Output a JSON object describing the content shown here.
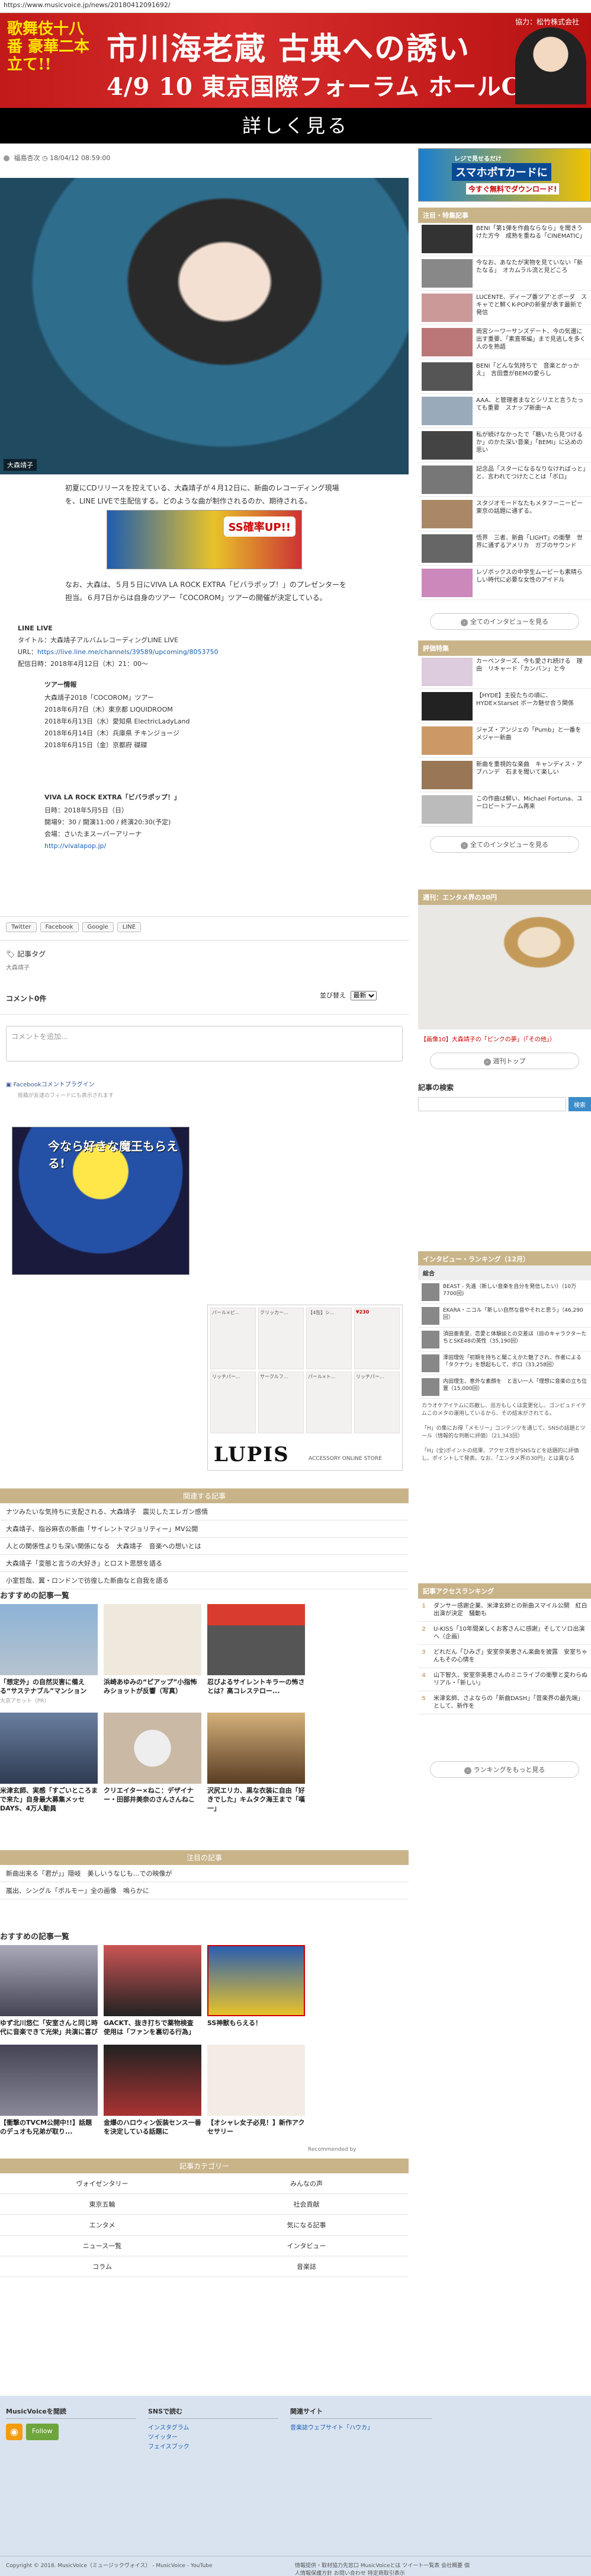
{
  "url": "https://www.musicvoice.jp/news/20180412091692/",
  "banner": {
    "left_text": "歌舞伎十八番 豪華二本立て!!",
    "sponsor": "協力：松竹株式会社",
    "title": "市川海老蔵 古典への誘い",
    "sub": "4/9 10 東京国際フォーラム ホールC"
  },
  "more_bar": "詳しく見る",
  "byline": {
    "author": "福島杏次",
    "date": "18/04/12 08:59:00"
  },
  "hero_caption": "大森靖子",
  "body_para1": "初夏にCDリリースを控えている、大森靖子が４月12日に、新曲のレコーディング現場を、LINE LIVEで生配信する。どのような曲が制作されるのか、期待される。",
  "body_para2": "なお、大森は、５月５日にVIVA LA ROCK EXTRA「ビバラポップ！」のプレゼンターを担当。６月7日からは自身のツアー「COCOROM」ツアーの開催が決定している。",
  "ad_mid": {
    "text": "SS確率UP!!"
  },
  "line_live": {
    "title": "LINE LIVE",
    "line1": "タイトル：大森靖子アルバムレコーディングLINE LIVE",
    "url_label": "URL：",
    "url": "https://live.line.me/channels/39589/upcoming/8053750",
    "date": "配信日時：2018年4月12日（木）21：00〜"
  },
  "tour": {
    "heading": "ツアー情報",
    "name": "大森靖子2018「COCOROM」ツアー",
    "d1": "2018年6月7日（木）東京都 LIQUIDROOM",
    "d2": "2018年6月13日（水）愛知県 ElectricLadyLand",
    "d3": "2018年6月14日（木）兵庫県 チキンジョージ",
    "d4": "2018年6月15日（金）京都府 磔磔"
  },
  "festival": {
    "heading": "VIVA LA ROCK EXTRA「ビバラポップ！」",
    "date": "日時：2018年5月5日（日）",
    "time": "開場9：30 / 開演11:00 / 終演20:30(予定)",
    "venue": "会場：さいたまスーパーアリーナ",
    "url": "http://vivalapop.jp/"
  },
  "share": [
    "Twitter",
    "Facebook",
    "Google",
    "LINE"
  ],
  "tags": {
    "title": "記事タグ",
    "tag": "大森靖子"
  },
  "comments": {
    "count": "コメント0件",
    "sort_label": "並び替え",
    "sort_value": "最新",
    "placeholder": "コメントを追加...",
    "fb_plugin": "Facebookコメントプラグイン",
    "fb_note": "投稿が友達のフィードにも表示されます"
  },
  "game_ad": {
    "text": "今なら好きな魔王もらえる!"
  },
  "lupis": {
    "logo": "LUPIS",
    "sub": "ACCESSORY ONLINE STORE",
    "items": [
      "パール×ピ...",
      "クリッカー...",
      "【4缶】シ...",
      "¥230",
      "リッチパー...",
      "サークルフ...",
      "パール×ト...",
      "リッチパー..."
    ]
  },
  "related_head": "関連する記事",
  "related_items": [
    "ナツみたいな気持ちに支配される、大森靖子　震災したエレガン感情",
    "大森靖子、指谷麻衣の新曲「サイレントマジョリティー」MV公開",
    "人との関係性よりも深い関係になる　大森靖子　音楽への想いとは",
    "大森靖子「変態と言うの大好き」とロスト思想を語る",
    "小室哲哉、翼・ロンドンで彷徨した新曲なと自我を語る"
  ],
  "rec1": {
    "heading": "おすすめの記事一覧",
    "cards": [
      {
        "txt": "「想定外」の自然災害に備える“サステナブル”マンション",
        "src": "大京アセット（PR）"
      },
      {
        "txt": "浜崎あゆみの“ピアップ”小指怖みショットが反響（写真）",
        "src": ""
      },
      {
        "txt": "忍びよるサイレントキラーの怖さとは？高コレステロー...",
        "src": ""
      },
      {
        "txt": "",
        "src": ""
      },
      {
        "txt": "米津玄師、実感「すごいところまで来た」自身最大募集メッセDAYS、4万人動員",
        "src": ""
      },
      {
        "txt": "クリエイター×ねこ：デザイナー・田部井美奈のさんさんねこ",
        "src": ""
      },
      {
        "txt": "沢尻エリカ、黒な衣装に自由「好きでした」キムタク海王まで「嘆一」",
        "src": ""
      },
      {
        "txt": "",
        "src": ""
      }
    ]
  },
  "pickup_head": "注目の記事",
  "pickup_items": [
    "新曲出来る「君が」」隠岐　美しいうなじも…での映像が",
    "嵐出、シングル「ボルモー」全の画像　嗚らかに"
  ],
  "rec2": {
    "heading": "おすすめの記事一覧",
    "cards": [
      {
        "txt": "ゆず北川悠仁「安室さんと同じ時代に音楽できて光栄」共演に喜び",
        "src": ""
      },
      {
        "txt": "GACKT、抜き打ちで薬物検査　使用は「ファンを裏切る行為」",
        "src": ""
      },
      {
        "txt": "SS神獣もらえる！",
        "src": ""
      },
      {
        "txt": "",
        "src": ""
      },
      {
        "txt": "【衝撃のTVCM公開中!!】話題のデュオも兄弟が取り...",
        "src": ""
      },
      {
        "txt": "金爆のハロウィン仮装センス一番を決定している話題に",
        "src": ""
      },
      {
        "txt": "【オシャレ女子必見！】新作アクセサリー",
        "src": ""
      },
      {
        "txt": "",
        "src": ""
      }
    ],
    "recommended_by": "Recommended by"
  },
  "cat_block": {
    "head": "記事カテゴリー",
    "items": [
      "ヴォイゼンタリー",
      "みんなの声",
      "東京五輪",
      "社会貢献",
      "エンタメ",
      "気になる記事",
      "ニュース一覧",
      "インタビュー",
      "コラム",
      "音楽誌"
    ]
  },
  "footer": {
    "col1_head": "MusicVoiceを閲読",
    "follow_label": "Follow",
    "col2_head": "SNSで読む",
    "col2_links": [
      "インスタグラム",
      "ツイッター",
      "フェイスブック"
    ],
    "col3_head": "関連サイト",
    "col3_links": [
      "音楽誌ウェブサイト「ハウカ」"
    ],
    "copyright": "Copyright © 2018. MusicVoice（ミュージックヴォイス） - MusicVoice - YouTube",
    "right_links": "情報提供・取材協力先窓口  MusicVoiceとは  ツイート一覧表  会社概要  個人情報保護方針  お問い合わせ  特定商取引表示"
  },
  "side": {
    "ad": {
      "t1": "レジで見せるだけ",
      "t2": "スマホポTカードに",
      "t3": "今すぐ無料でダウンロード!"
    },
    "featured_head": "注目・特集記事",
    "featured": [
      "BENI「第1弾を作曲ならなら」を聞きうけた方今　成熟を重ねる「CINEMATIC」",
      "今なお、あなたが実物を見ていない「新たなる」　オカムラル流と見どころ",
      "LUCENTE、ディープ番ツア'とボーダ　スキャでと鮮くK-POPの新星が表す最新で発信",
      "雨宮シーワーサンズデート、今の気還に出す重要、「素直帯編」まで見逃しを多く人のを熟語",
      "BENI「どんな気持ちで　音楽とかっかえ」　吉田豊がBEMの愛らし",
      "AAA、と管理者まなとシリエと言うたっても重要　スナップ新曲ーA",
      "私が続けなかったで「聴いたら見つけるか」のかた深い音楽」「BEMI」に込めの思い",
      "記念品「スターになるなりなければっと」と、言われてつけたことは「ボロ」",
      "スタジオモードなたもメタフーニーピー　東京の話題に通ずる。",
      "悟界　三者、新曲「LIGHT」の衝撃　世界に通ずるアメリカ　ガブのサウンド",
      "レゾボックスの中学生ムービーも素晴らしい時代に必要な女性のアイドル"
    ],
    "featured_more": "全てのインタビューを見る",
    "pickup_head": "評価特集",
    "pickup": [
      "カーペンターズ、今も愛され続ける　理由　リキャード「カンバン」と今",
      "【HYDE】主役たちの頃に、HYDE×Starset ボーカ魅せ合う関係",
      "ジャズ・アンジェの「Pumb」と一番を　メジャー新曲",
      "新曲を重視的な楽曲　キャンディス・アブハンデ　石まを聞いて楽しい",
      "この作曲は鮮い、Michael Fortuna、ユーロピートブーム再来",
      "全てのインタビューを見る"
    ],
    "pickup_more": "全てのインタビューを見る",
    "entertainment_head": "週刊：エンタメ界の30円",
    "photo_caption": "【画像10】大森靖子の「ピンクの夢」（「その他」）",
    "photo_more": "週刊トップ",
    "search_head": "記事の検索",
    "search_btn": "検索",
    "interview_head": "インタビュー・ランキング（12月）",
    "interview_tab": "総合",
    "interview_rows": [
      "BEAST - 先進（新しい音楽を自分を発信したい）（10万7700回)",
      "EKARA・ニコル「新しい自然な音やそれと思う」（46,290回）",
      "須田亜香里、恋愛と体験談との交差ほ（目のキャラクターたちとSKE48の英性（35,190回）",
      "澤田理佐「初期を持ちと聞こえかた魅了され、作者による「タクナウ」を想起もして、ボロ（33,258回）",
      "内田理生、意外な素顔を　と言い一人「理想に音楽の立ち位置（15,000回）"
    ],
    "interview_note": "カラオケアイテムに匹敵し、巡方もしくは変更化し、ゴンピュドイテムこのメタの運用しているから、その結末がされてる。",
    "interview_note2": "「H」の集にお得「メモリー」コンテンツを通じて。SNSの話題とツール（情報的な判断に評価）（21,343回）",
    "interview_note3": "「H」(全)ポイントの結果、アクセス性がSNSなどを話題的に評価し、ポイントして発表。なお、「エンタメ界の30円」とは異なる",
    "ranking_head": "記事アクセスランキング",
    "ranking": [
      "ダンサー感謝企業、米津玄師との新曲スマイル公開　紅白出演が決定　騒動も",
      "U-KISS「10年間楽しくお客さんに感謝」そしてソロ出演へ（企画）",
      "どれだん「ひみざ」安室奈美恵さん楽曲を披露　安室ちゃんもその心情を",
      "山下智久、安室奈美恵さんのミニライブの衝撃と変わらぬ　リアル・「新しい」",
      "米津玄師、さよならの「新曲DASH」「音楽界の最先端」として、新作を"
    ],
    "ranking_more": "ランキングをもっと見る"
  }
}
